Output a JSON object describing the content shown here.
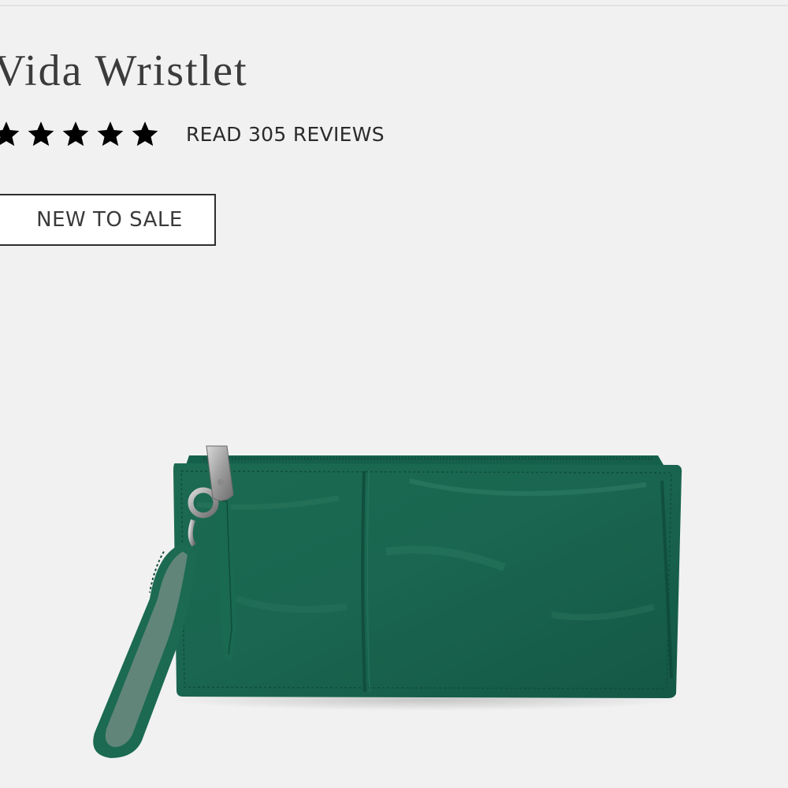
{
  "product": {
    "title": "Vida Wristlet",
    "rating": {
      "value": 5,
      "max": 5,
      "reviews_link": "READ 305 REVIEWS"
    },
    "badge": "NEW TO SALE",
    "image": {
      "subject": "green leather wristlet clutch with silver zipper pull",
      "main_color": "#1e6b53"
    }
  },
  "colors": {
    "background": "#f1f1f1",
    "title_text": "#3b3b3b",
    "star": "#000000",
    "badge_border": "#2e2e2e"
  }
}
